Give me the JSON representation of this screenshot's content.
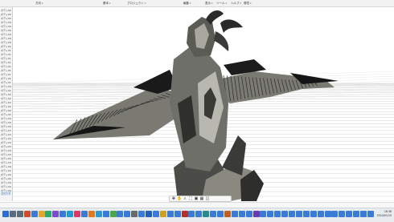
{
  "menubar": {
    "items": [
      "方向",
      "基本",
      "プロジェクト",
      "編集",
      "表示",
      "ヘルプ",
      "ツール",
      "環境"
    ]
  },
  "leftpanel": {
    "items": [
      "ボディ001",
      "ボディ002",
      "ボディ003",
      "ボディ004",
      "ボディ005",
      "ボディ006",
      "ボディ007",
      "ボディ008",
      "ボディ009",
      "ボディ010",
      "ボディ011",
      "ボディ012",
      "ボディ013",
      "ボディ014",
      "ボディ015",
      "ボディ016",
      "ボディ017",
      "ボディ018",
      "ボディ019",
      "ボディ020",
      "ボディ021",
      "ボディ022",
      "ボディ023",
      "ボディ024",
      "ボディ025",
      "ボディ026",
      "ボディ027",
      "ボディ028",
      "ボディ029",
      "ボディ030",
      "ボディ031",
      "ボディ032",
      "ボディ033",
      "ボディ034",
      "ボディ035",
      "ボディ036",
      "ボディ037",
      "ボディ038",
      "ボディ039",
      "ボディ040",
      "ボディ041",
      "ボディ042",
      "ボディ043",
      "ボディ044",
      "ボディ045",
      "ボディ046"
    ],
    "selected_label": "コメント"
  },
  "viewport_toolbar": {
    "buttons": [
      "move-icon",
      "hand-icon",
      "zoom-icon",
      "zoom-fit-icon",
      "display-icon",
      "grid-icon",
      "viewports-icon"
    ]
  },
  "taskbar": {
    "clock_time": "16:38",
    "clock_date": "2024/01/15",
    "icons": [
      {
        "name": "start-icon",
        "color": "#2b6fd6"
      },
      {
        "name": "search-icon",
        "color": "#5a6b7b"
      },
      {
        "name": "task-view-icon",
        "color": "#5a6b7b"
      },
      {
        "name": "app-icon",
        "color": "#d04a2b"
      },
      {
        "name": "app-icon",
        "color": "#3a7bd5"
      },
      {
        "name": "app-icon",
        "color": "#e5a42b"
      },
      {
        "name": "app-icon",
        "color": "#2ba86a"
      },
      {
        "name": "app-icon",
        "color": "#7a4bd0"
      },
      {
        "name": "app-icon",
        "color": "#3a7bd5"
      },
      {
        "name": "app-icon",
        "color": "#1e9bd7"
      },
      {
        "name": "app-icon",
        "color": "#d63a6a"
      },
      {
        "name": "app-icon",
        "color": "#3a7bd5"
      },
      {
        "name": "app-icon",
        "color": "#e07a20"
      },
      {
        "name": "app-icon",
        "color": "#2b9ad0"
      },
      {
        "name": "app-icon",
        "color": "#3a7bd5"
      },
      {
        "name": "app-icon",
        "color": "#4aa84a"
      },
      {
        "name": "app-icon",
        "color": "#3a7bd5"
      },
      {
        "name": "app-icon",
        "color": "#3a7bd5"
      },
      {
        "name": "app-icon",
        "color": "#6a6a6a"
      },
      {
        "name": "app-icon",
        "color": "#3a7bd5"
      },
      {
        "name": "app-icon",
        "color": "#1f5fb8"
      },
      {
        "name": "app-icon",
        "color": "#3a7bd5"
      },
      {
        "name": "app-icon",
        "color": "#d0a020"
      },
      {
        "name": "app-icon",
        "color": "#3a7bd5"
      },
      {
        "name": "app-icon",
        "color": "#3a7bd5"
      },
      {
        "name": "app-icon",
        "color": "#b03030"
      },
      {
        "name": "app-icon",
        "color": "#3a7bd5"
      },
      {
        "name": "app-icon",
        "color": "#3a7bd5"
      },
      {
        "name": "app-icon",
        "color": "#2a8a8a"
      },
      {
        "name": "app-icon",
        "color": "#3a7bd5"
      },
      {
        "name": "app-icon",
        "color": "#3a7bd5"
      },
      {
        "name": "app-icon",
        "color": "#c06020"
      },
      {
        "name": "app-icon",
        "color": "#3a7bd5"
      },
      {
        "name": "app-icon",
        "color": "#3a7bd5"
      },
      {
        "name": "app-icon",
        "color": "#3a7bd5"
      },
      {
        "name": "app-icon",
        "color": "#6a3ab0"
      },
      {
        "name": "app-icon",
        "color": "#3a7bd5"
      },
      {
        "name": "app-icon",
        "color": "#3a7bd5"
      },
      {
        "name": "app-icon",
        "color": "#3a7bd5"
      },
      {
        "name": "app-icon",
        "color": "#3a7bd5"
      },
      {
        "name": "app-icon",
        "color": "#3a7bd5"
      },
      {
        "name": "app-icon",
        "color": "#3a7bd5"
      },
      {
        "name": "app-icon",
        "color": "#3a7bd5"
      },
      {
        "name": "app-icon",
        "color": "#3a7bd5"
      },
      {
        "name": "app-icon",
        "color": "#3a7bd5"
      },
      {
        "name": "app-icon",
        "color": "#3a7bd5"
      },
      {
        "name": "app-icon",
        "color": "#3a7bd5"
      },
      {
        "name": "app-icon",
        "color": "#3a7bd5"
      },
      {
        "name": "app-icon",
        "color": "#3a7bd5"
      },
      {
        "name": "app-icon",
        "color": "#3a7bd5"
      },
      {
        "name": "app-icon",
        "color": "#3a7bd5"
      },
      {
        "name": "app-icon",
        "color": "#3a7bd5"
      }
    ]
  },
  "colors": {
    "model_dark": "#2a2a2a",
    "model_mid": "#6f6f6a",
    "model_light": "#b9b8b0",
    "grid": "#c8c8c8"
  }
}
